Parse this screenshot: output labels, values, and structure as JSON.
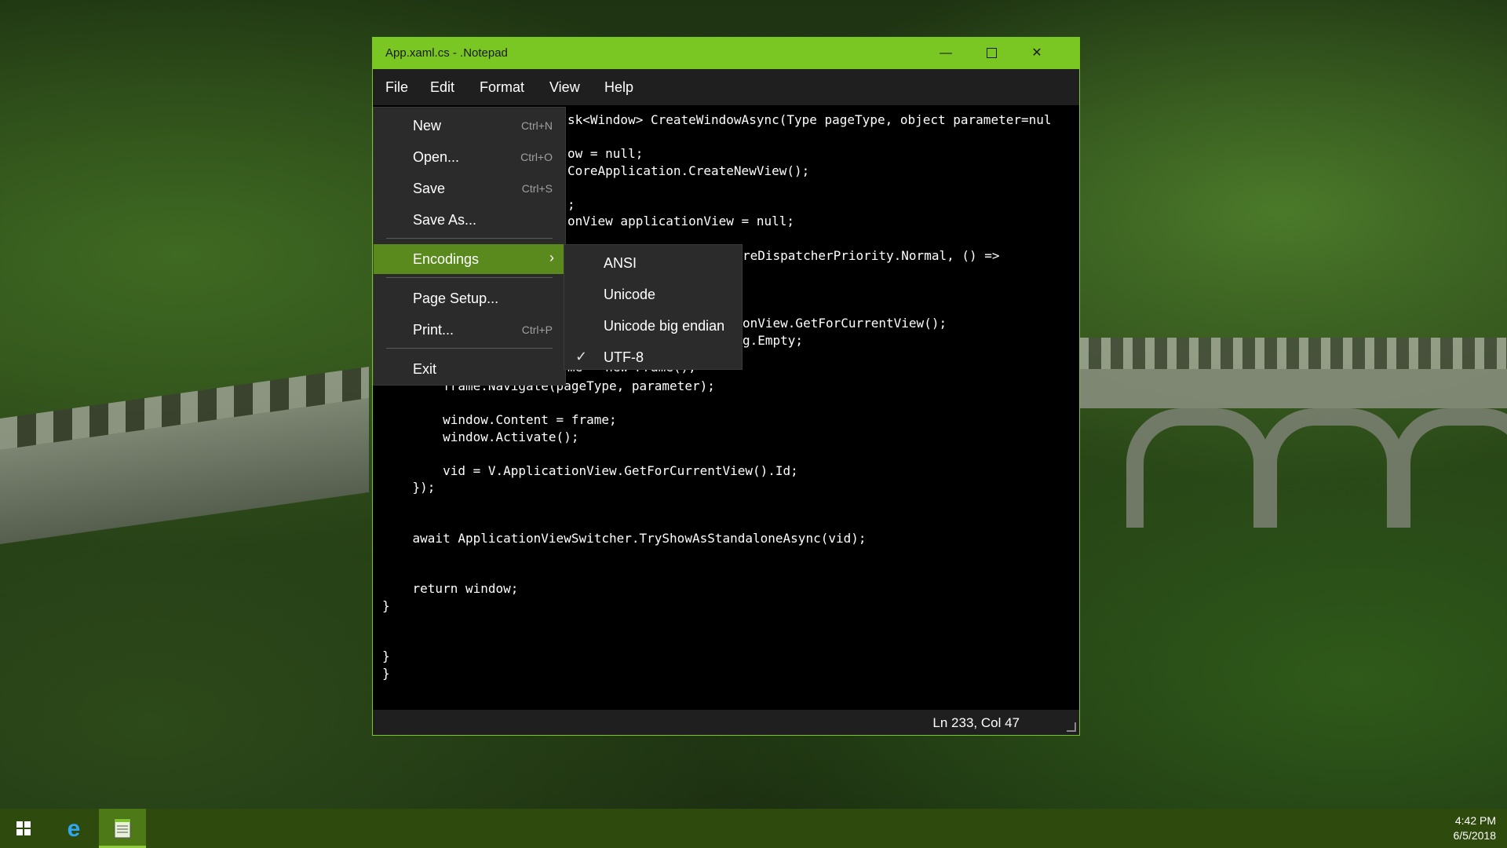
{
  "window": {
    "title": "App.xaml.cs - .Notepad"
  },
  "menubar": [
    "File",
    "Edit",
    "Format",
    "View",
    "Help"
  ],
  "file_menu": {
    "items": [
      {
        "label": "New",
        "shortcut": "Ctrl+N"
      },
      {
        "label": "Open...",
        "shortcut": "Ctrl+O"
      },
      {
        "label": "Save",
        "shortcut": "Ctrl+S"
      },
      {
        "label": "Save As...",
        "shortcut": ""
      },
      {
        "label": "Encodings",
        "shortcut": ""
      },
      {
        "label": "Page Setup...",
        "shortcut": ""
      },
      {
        "label": "Print...",
        "shortcut": "Ctrl+P"
      },
      {
        "label": "Exit",
        "shortcut": ""
      }
    ]
  },
  "encodings_menu": {
    "items": [
      "ANSI",
      "Unicode",
      "Unicode big endian",
      "UTF-8"
    ],
    "checked": "UTF-8"
  },
  "code": {
    "behind_menu": [
      "sk<Window> CreateWindowAsync(Type pageType, object parameter=nul",
      "",
      "ow = null;",
      "CoreApplication.CreateNewView();",
      "",
      ";",
      "onView applicationView = null;",
      ""
    ],
    "behind_submenu": [
      "reDispatcherPriority.Normal, () =>",
      "",
      "",
      "",
      "onView.GetForCurrentView();",
      "g.Empty;"
    ],
    "partial_left": "me = new Frame();",
    "lines": [
      "        frame.Navigate(pageType, parameter);",
      "",
      "        window.Content = frame;",
      "        window.Activate();",
      "",
      "        vid = V.ApplicationView.GetForCurrentView().Id;",
      "    });",
      "",
      "",
      "    await ApplicationViewSwitcher.TryShowAsStandaloneAsync(vid);",
      "",
      "",
      "    return window;",
      "}",
      "",
      "",
      "}",
      "}"
    ]
  },
  "status": {
    "position": "Ln 233, Col 47"
  },
  "taskbar": {
    "time": "4:42 PM",
    "date": "6/5/2018"
  }
}
